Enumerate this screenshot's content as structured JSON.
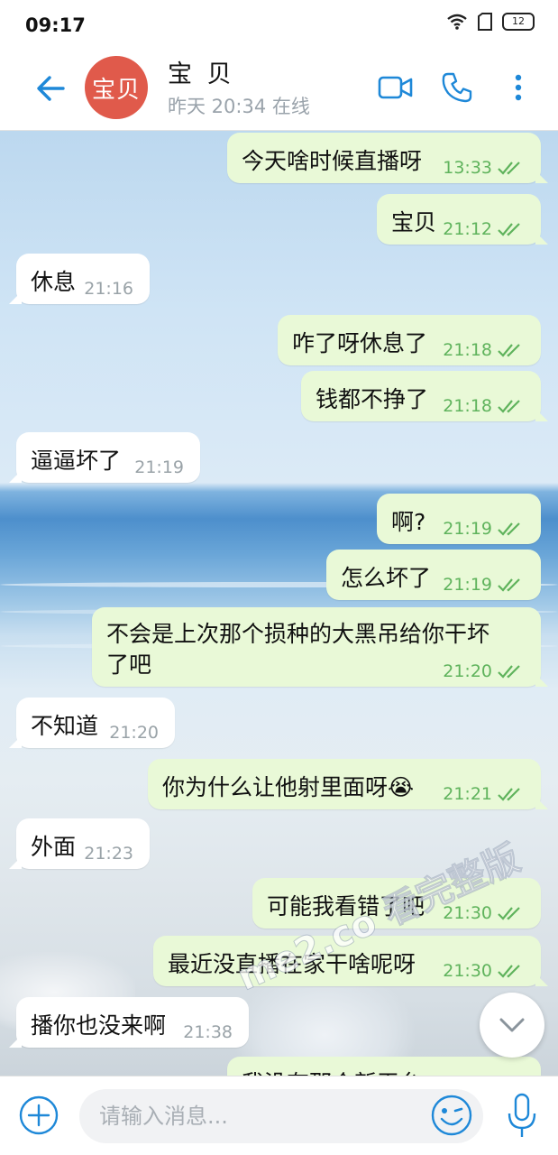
{
  "status_bar": {
    "time": "09:17",
    "battery": "12"
  },
  "header": {
    "avatar_text": "宝贝",
    "contact_name": "宝 贝",
    "contact_status": "昨天 20:34 在线"
  },
  "messages": [
    {
      "direction": "out",
      "text": "今天啥时候直播呀",
      "time": "13:33"
    },
    {
      "direction": "out",
      "text": "宝贝",
      "time": "21:12"
    },
    {
      "direction": "in",
      "text": "休息",
      "time": "21:16"
    },
    {
      "direction": "out",
      "text": "咋了呀休息了",
      "time": "21:18"
    },
    {
      "direction": "out",
      "text": "钱都不挣了",
      "time": "21:18"
    },
    {
      "direction": "in",
      "text": "逼逼坏了",
      "time": "21:19"
    },
    {
      "direction": "out",
      "text": "啊?",
      "time": "21:19"
    },
    {
      "direction": "out",
      "text": "怎么坏了",
      "time": "21:19"
    },
    {
      "direction": "out",
      "text_line1": "不会是上次那个损种的大黑吊给你干坏",
      "text_line2": "了吧",
      "time": "21:20"
    },
    {
      "direction": "in",
      "text": "不知道",
      "time": "21:20"
    },
    {
      "direction": "out",
      "text": "你为什么让他射里面呀😭",
      "time": "21:21"
    },
    {
      "direction": "in",
      "text": "外面",
      "time": "21:23"
    },
    {
      "direction": "out",
      "text": "可能我看错了吧",
      "time": "21:30"
    },
    {
      "direction": "out",
      "text": "最近没直播在家干啥呢呀",
      "time": "21:30"
    },
    {
      "direction": "in",
      "text": "播你也没来啊",
      "time": "21:38"
    },
    {
      "direction": "out",
      "text": "我没有那个新平台",
      "time": ""
    }
  ],
  "watermark": "me2.co 看完整版",
  "input": {
    "placeholder": "请输入消息..."
  },
  "colors": {
    "outgoing_bubble": "#e9f9d7",
    "incoming_bubble": "#ffffff",
    "accent": "#1e88d8",
    "read_ticks": "#5fb35c",
    "avatar": "#e05a4b"
  }
}
